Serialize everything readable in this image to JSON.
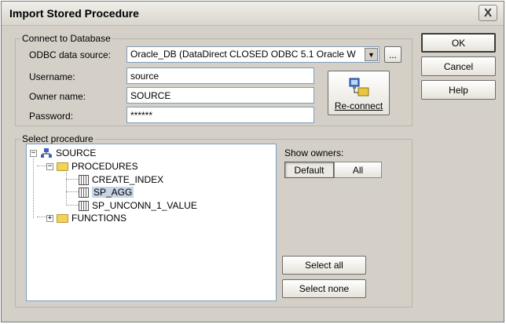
{
  "window": {
    "title": "Import Stored Procedure",
    "close_glyph": "X"
  },
  "connect": {
    "legend": "Connect to Database",
    "odbc_label": "ODBC data source:",
    "odbc_value": "Oracle_DB (DataDirect CLOSED ODBC 5.1 Oracle W",
    "browse_label": "...",
    "username_label": "Username:",
    "username_value": "source",
    "owner_label": "Owner name:",
    "owner_value": "SOURCE",
    "password_label": "Password:",
    "password_value": "******",
    "reconnect_label": "Re-connect"
  },
  "procedure": {
    "legend": "Select procedure",
    "tree": {
      "root": "SOURCE",
      "procedures": "PROCEDURES",
      "items": [
        "CREATE_INDEX",
        "SP_AGG",
        "SP_UNCONN_1_VALUE"
      ],
      "selected": "SP_AGG",
      "functions": "FUNCTIONS",
      "expanded_glyph": "−",
      "collapsed_glyph": "+"
    },
    "show_owners_label": "Show owners:",
    "owners_default": "Default",
    "owners_all": "All",
    "select_all": "Select all",
    "select_none": "Select none"
  },
  "buttons": {
    "ok": "OK",
    "cancel": "Cancel",
    "help": "Help"
  }
}
